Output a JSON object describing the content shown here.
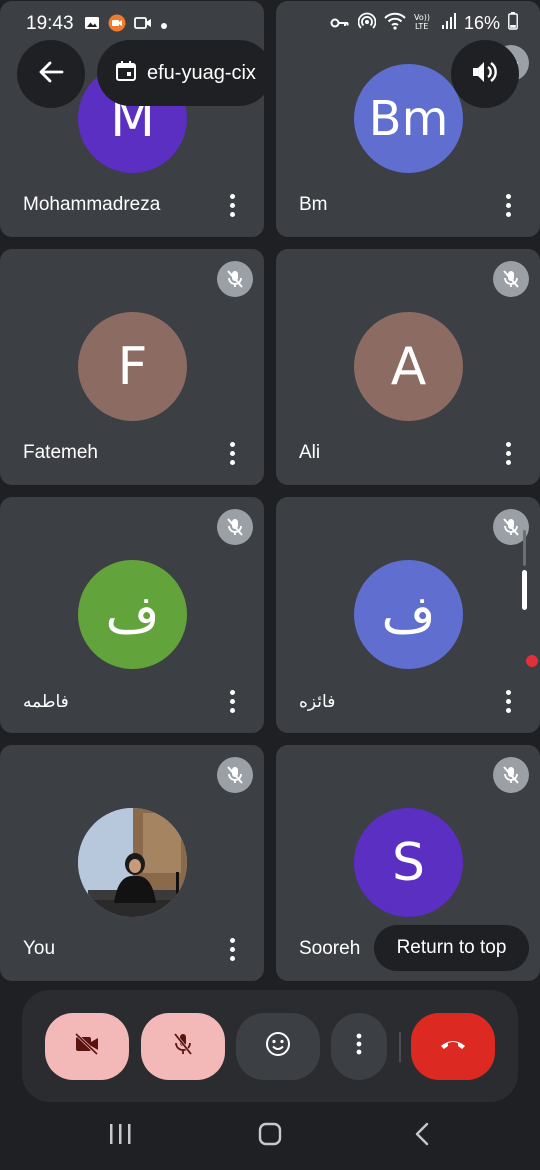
{
  "status": {
    "time": "19:43",
    "battery": "16%",
    "left_icons": [
      "image-icon",
      "screen-record-icon",
      "video-icon",
      "dot-icon"
    ],
    "right_icons": [
      "vpn-key-icon",
      "hotspot-icon",
      "wifi-icon",
      "volte-icon",
      "signal-icon",
      "battery-icon"
    ]
  },
  "header": {
    "meeting_code": "efu-yuag-cix",
    "icons": [
      "back-arrow-icon",
      "calendar-icon",
      "speaker-icon"
    ]
  },
  "participants": [
    {
      "name": "Mohammadreza",
      "initial": "M",
      "color": "#5b2fc2",
      "muted": false
    },
    {
      "name": "Bm",
      "initial": "Bm",
      "color": "#5f6ecf",
      "muted": true
    },
    {
      "name": "Fatemeh",
      "initial": "F",
      "color": "#8c6b62",
      "muted": true
    },
    {
      "name": "Ali",
      "initial": "A",
      "color": "#8c6b62",
      "muted": true
    },
    {
      "name": "فاطمه",
      "initial": "ف",
      "color": "#63a33b",
      "muted": true
    },
    {
      "name": "فائزه",
      "initial": "ف",
      "color": "#5f6ecf",
      "muted": true
    },
    {
      "name": "You",
      "initial": "",
      "color": "#5a6a7a",
      "muted": true
    },
    {
      "name": "Sooreh",
      "initial": "S",
      "color": "#5b2fc2",
      "muted": true
    }
  ],
  "return_to_top": "Return to top",
  "controls": [
    "camera-off-icon",
    "mic-off-icon",
    "emoji-icon",
    "more-vert-icon",
    "end-call-icon"
  ],
  "nav": [
    "recent-apps-icon",
    "home-icon",
    "back-icon"
  ],
  "colors": {
    "background": "#1f2023",
    "tile": "#3c3f43",
    "pink_button": "#f3b8b8",
    "end_call": "#dc2a22"
  }
}
